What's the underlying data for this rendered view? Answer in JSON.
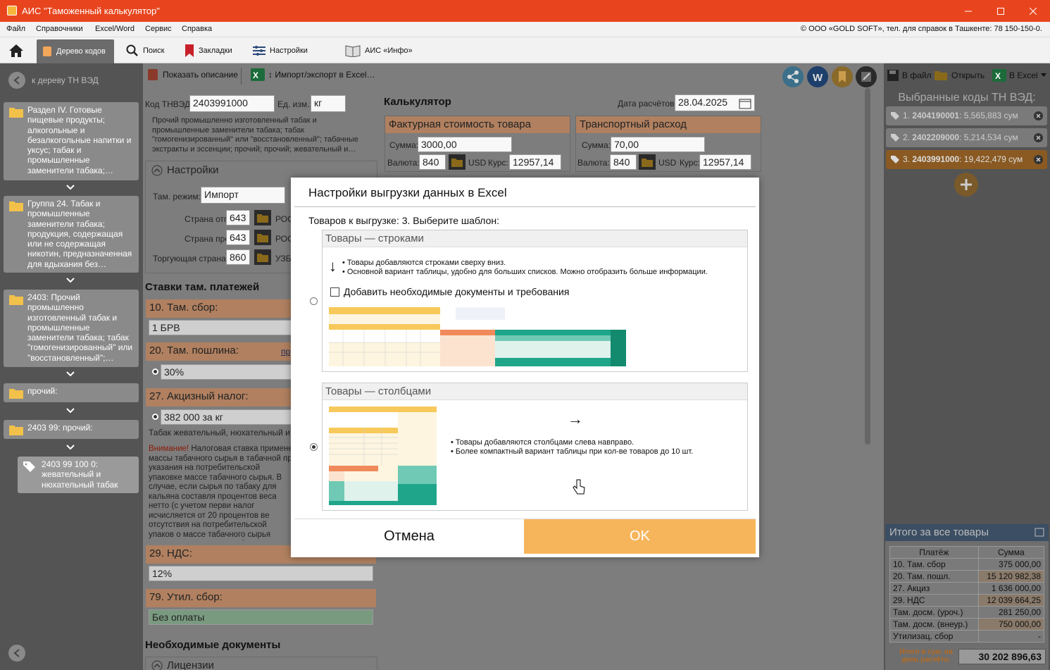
{
  "window": {
    "title": "АИС \"Таможенный калькулятор\""
  },
  "menu": {
    "items": [
      "Файл",
      "Справочники",
      "Excel/Word",
      "Сервис",
      "Справка"
    ],
    "copyright": "© ООО «GOLD SOFT», тел. для справок в Ташкенте: 78 150-150-0."
  },
  "toolbar": {
    "tree_label": "Дерево кодов",
    "search_label": "Поиск",
    "bookmarks_label": "Закладки",
    "settings_label": "Настройки",
    "info_label": "АИС «Инфо»"
  },
  "left": {
    "back_label": "к дереву ТН ВЭД",
    "nodes": [
      "Раздел IV. Готовые пищевые продукты; алкогольные и безалкогольные напитки и уксус; табак и промышленные заменители табака;…",
      "Группа 24. Табак и промышленные заменители табака; продукция, содержащая или не содержащая никотин, предназначенная для вдыхания без…",
      "2403: Прочий промышленно изготовленный табак и промышленные заменители табака; табак \"гомогенизированный\" или \"восстановленный\";…",
      "прочий:",
      "2403 99: прочий:",
      "2403 99 100 0: жевательный и нюхательный табак"
    ]
  },
  "actions": {
    "show_description": "Показать описание",
    "import_export": "↕ Импорт/экспорт в Excel…",
    "to_file": "В файл",
    "open": "Открыть",
    "to_excel": "В Excel"
  },
  "product": {
    "code_label": "Код ТНВЭД:",
    "code": "2403991000",
    "unit_label": "Ед. изм.:",
    "unit": "кг",
    "description": "Прочий промышленно изготовленный табак и промышленные заменители табака; табак \"гомогенизированный\" или \"восстановленный\"; табачные экстракты и эссенции; прочий; прочий; жевательный и…",
    "settings_title": "Настройки",
    "regime_label": "Там. режим:",
    "regime": "Импорт",
    "origin_send_label": "Страна отправ.:",
    "origin_send": "643",
    "origin_send_name": "РОС",
    "origin_label": "Страна происх.:",
    "origin": "643",
    "origin_name": "РОС",
    "trade_label": "Торгующая страна:",
    "trade": "860",
    "trade_name": "УЗБ"
  },
  "rates": {
    "title": "Ставки там. платежей",
    "fee_title": "10. Там. сбор:",
    "fee_value": "1 БРВ",
    "duty_title": "20. Там. пошлина:",
    "duty_link": "пр",
    "duty_value": "30%",
    "excise_title": "27. Акцизный налог:",
    "excise_value": "382 000 за кг",
    "excise_desc": "Табак жевательный, нюхательный и",
    "warning_label": "Внимание!",
    "warning_text": "Налоговая ставка примене массы табачного сырья в табачной пр указания на потребительской упаковке массе табачного сырья. В случае, если сырья по табаку для кальяна составля процентов веса нетто (с учетом перви налог исчисляется от 20 процентов ве отсутствия на потребительской упаков о массе табачного сырья налоговая ст весу нетто (с учетом первичной упак",
    "vat_title": "29. НДС:",
    "vat_value": "12%",
    "util_title": "79. Утил. сбор:",
    "util_value": "Без оплаты",
    "docs_title": "Необходимые документы",
    "licenses": "Лицензии"
  },
  "calc": {
    "title": "Калькулятор",
    "date_label": "Дата расчётов:",
    "date": "28.04.2025",
    "invoice_title": "Фактурная стоимость товара",
    "transport_title": "Транспортный расход",
    "sum_label": "Сумма:",
    "invoice_sum": "3000,00",
    "transport_sum": "70,00",
    "currency_label": "Валюта:",
    "currency_code": "840",
    "currency": "USD",
    "rate_label": "Курс:",
    "rate": "12957,14"
  },
  "selected": {
    "title": "Выбранные коды ТН ВЭД:",
    "items": [
      {
        "num": "1.",
        "code": "2404190001",
        "sum": ": 5,565,883 сум"
      },
      {
        "num": "2.",
        "code": "2402209000",
        "sum": ": 5,214,534 сум"
      },
      {
        "num": "3.",
        "code": "2403991000",
        "sum": ": 19,422,479 сум"
      }
    ]
  },
  "totals": {
    "title": "Итого за все товары",
    "col_payment": "Платёж",
    "col_sum": "Сумма",
    "rows": [
      {
        "name": "10. Там. сбор",
        "sum": "375 000,00"
      },
      {
        "name": "20. Там. пошл.",
        "sum": "15 120 982,38"
      },
      {
        "name": "27. Акциз",
        "sum": "1 636 000,00"
      },
      {
        "name": "29. НДС",
        "sum": "12 039 664,25"
      },
      {
        "name": "Там. досм. (уроч.)",
        "sum": "281 250,00"
      },
      {
        "name": "Там. досм. (внеур.)",
        "sum": "750 000,00"
      },
      {
        "name": "Утилизац. сбор",
        "sum": "-"
      }
    ],
    "grand_label": "Итого в сум. на день расчёта:",
    "grand_value": "30 202 896,63"
  },
  "dialog": {
    "title": "Настройки выгрузки данных в Excel",
    "subtitle": "Товаров к выгрузке: 3. Выберите шаблон:",
    "rows_title": "Товары — строками",
    "rows_arrow": "↓",
    "rows_line1": "• Товары добавляются строками сверху вниз.",
    "rows_line2": "• Основной вариант таблицы, удобно для больших списков. Можно отобразить больше информации.",
    "rows_checkbox": "Добавить необходимые документы и требования",
    "cols_title": "Товары — столбцами",
    "cols_arrow": "→",
    "cols_line1": "• Товары добавляются столбцами слева навправо.",
    "cols_line2": "• Более компактный вариант таблицы при кол-ве товаров до 10 шт.",
    "cancel": "Отмена",
    "ok": "OK",
    "selected_template": "columns"
  },
  "colors": {
    "titlebar": "#e8451e",
    "accent": "#f7b55b",
    "selected_code": "#e8953a"
  }
}
